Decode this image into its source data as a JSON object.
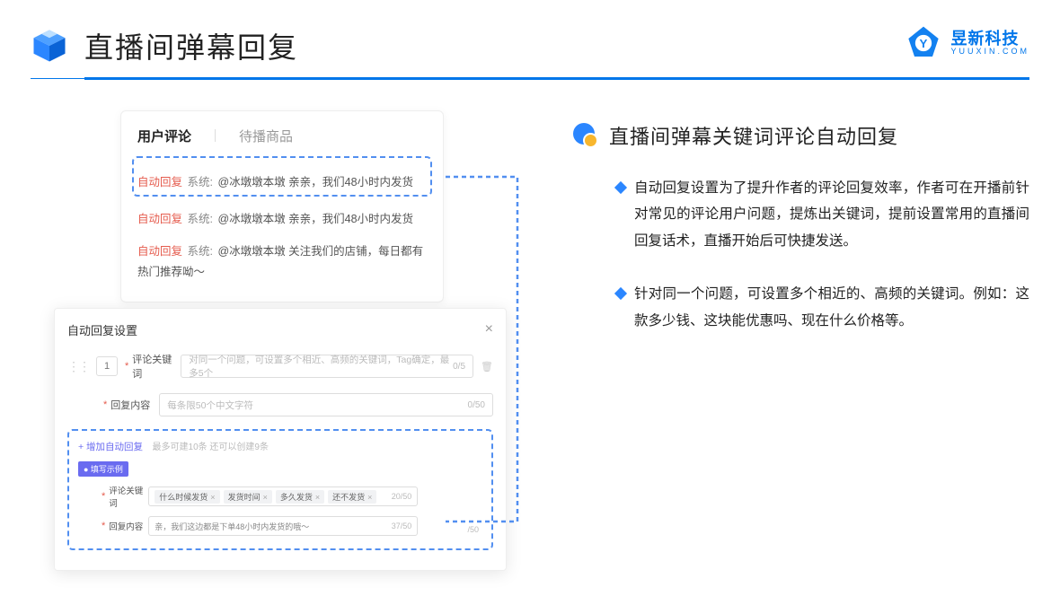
{
  "header": {
    "title": "直播间弹幕回复"
  },
  "brand": {
    "name": "昱新科技",
    "sub": "YUUXIN.COM"
  },
  "comments": {
    "tabs": {
      "active": "用户评论",
      "inactive": "待播商品"
    },
    "items": [
      {
        "tag": "自动回复",
        "sys": "系统:",
        "text": "@冰墩墩本墩 亲亲，我们48小时内发货",
        "hl": true
      },
      {
        "tag": "自动回复",
        "sys": "系统:",
        "text": "@冰墩墩本墩 亲亲，我们48小时内发货",
        "hl": false
      },
      {
        "tag": "自动回复",
        "sys": "系统:",
        "text": "@冰墩墩本墩 关注我们的店铺，每日都有热门推荐呦～",
        "hl": false
      }
    ]
  },
  "settings": {
    "title": "自动回复设置",
    "idx": "1",
    "kw_label": "评论关键词",
    "kw_placeholder": "对同一个问题，可设置多个相近、高频的关键词，Tag确定，最多5个",
    "kw_count": "0/5",
    "ct_label": "回复内容",
    "ct_placeholder": "每条限50个中文字符",
    "ct_count": "0/50",
    "add_label": "+ 增加自动回复",
    "add_hint": "最多可建10条 还可以创建9条",
    "example_badge": "● 填写示例",
    "ex_kw_label": "评论关键词",
    "ex_chips": [
      "什么时候发货",
      "发货时间",
      "多久发货",
      "还不发货"
    ],
    "ex_kw_count": "20/50",
    "ex_ct_label": "回复内容",
    "ex_ct_text": "亲，我们这边都是下单48小时内发货的哦～",
    "ex_ct_count": "37/50",
    "extra_count": "/50"
  },
  "right": {
    "title": "直播间弹幕关键词评论自动回复",
    "p1": "自动回复设置为了提升作者的评论回复效率，作者可在开播前针对常见的评论用户问题，提炼出关键词，提前设置常用的直播间回复话术，直播开始后可快捷发送。",
    "p2": "针对同一个问题，可设置多个相近的、高频的关键词。例如：这款多少钱、这块能优惠吗、现在什么价格等。"
  }
}
